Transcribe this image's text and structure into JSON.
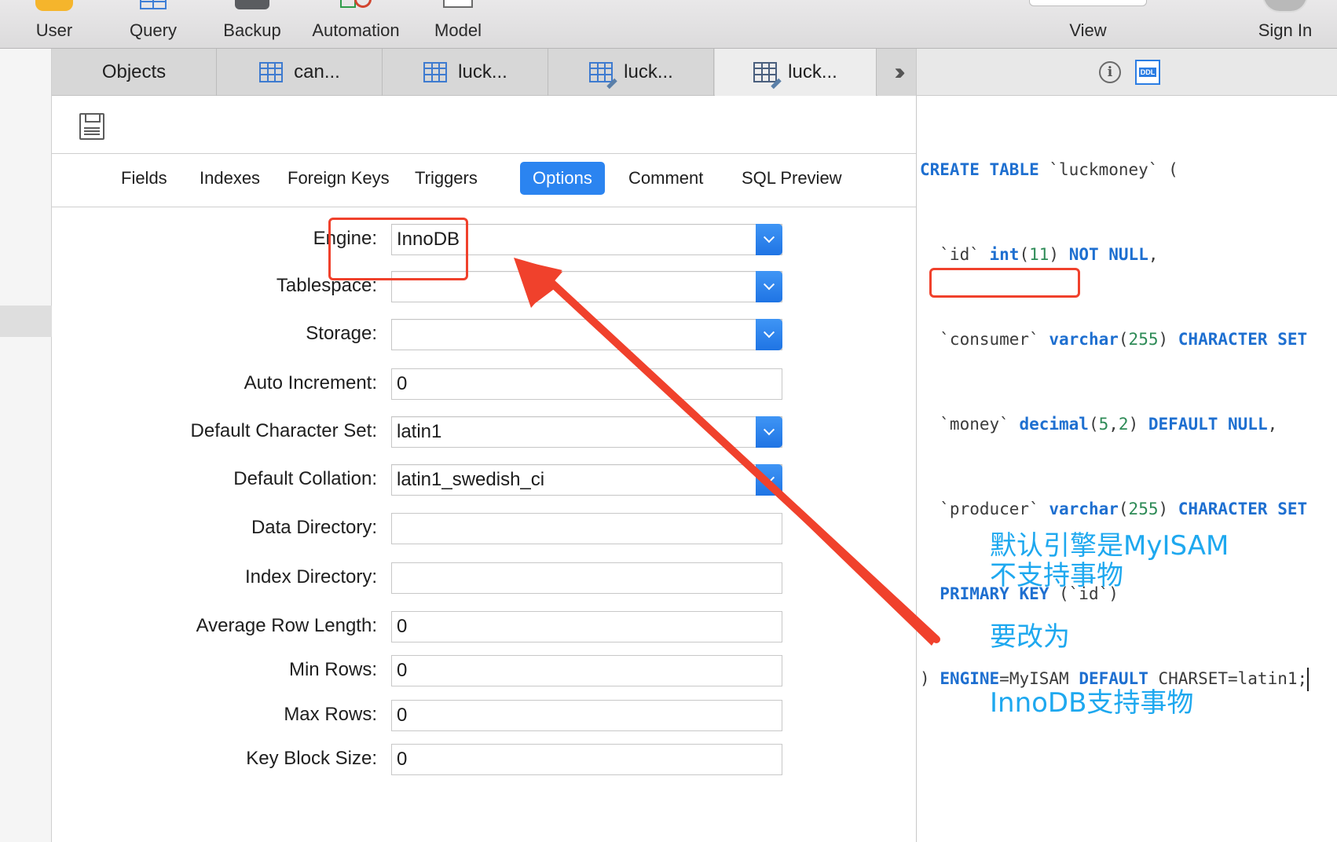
{
  "toolbar": {
    "user": "User",
    "query": "Query",
    "backup": "Backup",
    "automation": "Automation",
    "model": "Model",
    "view": "View",
    "sign_in": "Sign In"
  },
  "tabs": [
    {
      "label": "Objects"
    },
    {
      "label": "can..."
    },
    {
      "label": "luck..."
    },
    {
      "label": "luck..."
    },
    {
      "label": "luck..."
    }
  ],
  "subtabs": [
    "Fields",
    "Indexes",
    "Foreign Keys",
    "Triggers",
    "Options",
    "Comment",
    "SQL Preview"
  ],
  "active_subtab": "Options",
  "form": {
    "engine": {
      "label": "Engine:",
      "value": "InnoDB"
    },
    "tablespace": {
      "label": "Tablespace:",
      "value": ""
    },
    "storage": {
      "label": "Storage:",
      "value": ""
    },
    "auto_increment": {
      "label": "Auto Increment:",
      "value": "0"
    },
    "charset": {
      "label": "Default Character Set:",
      "value": "latin1"
    },
    "collation": {
      "label": "Default Collation:",
      "value": "latin1_swedish_ci"
    },
    "data_dir": {
      "label": "Data Directory:",
      "value": ""
    },
    "index_dir": {
      "label": "Index Directory:",
      "value": ""
    },
    "avg_row_length": {
      "label": "Average Row Length:",
      "value": "0"
    },
    "min_rows": {
      "label": "Min Rows:",
      "value": "0"
    },
    "max_rows": {
      "label": "Max Rows:",
      "value": "0"
    },
    "key_block_size": {
      "label": "Key Block Size:",
      "value": "0"
    }
  },
  "ddl": {
    "info_icon": "i",
    "ddl_badge": "DDL",
    "tokens": {
      "create_table": "CREATE TABLE",
      "table_name": " `luckmoney` (",
      "id_col": "  `id` ",
      "int_kw": "int",
      "int_args_open": "(",
      "int_len": "11",
      "int_args_close": ") ",
      "not_null": "NOT NULL",
      "comma": ",",
      "consumer_col": "  `consumer` ",
      "varchar_kw": "varchar",
      "v255": "255",
      "character_set": "CHARACTER SET",
      "money_col": "  `money` ",
      "decimal_kw": "decimal",
      "d5": "5",
      "d2": "2",
      "default_null": "DEFAULT NULL",
      "producer_col": "  `producer` ",
      "primary_key": "PRIMARY KEY",
      "pk_rest": " (`id`)",
      "close_paren": ")",
      "engine_kw": "ENGINE",
      "engine_rest": "=MyISAM",
      "default_kw": "DEFAULT",
      "charset_rest": " CHARSET=latin1;"
    }
  },
  "notes": {
    "line1": "默认引擎是MyISAM",
    "line2": "不支持事物",
    "line3": "要改为",
    "line4": "InnoDB支持事物"
  },
  "colors": {
    "accent": "#2b84f0",
    "annotation_red": "#f0412c",
    "note_blue": "#1ea8ef",
    "keyword_blue": "#1e6fd0",
    "number_green": "#2e8b57"
  }
}
